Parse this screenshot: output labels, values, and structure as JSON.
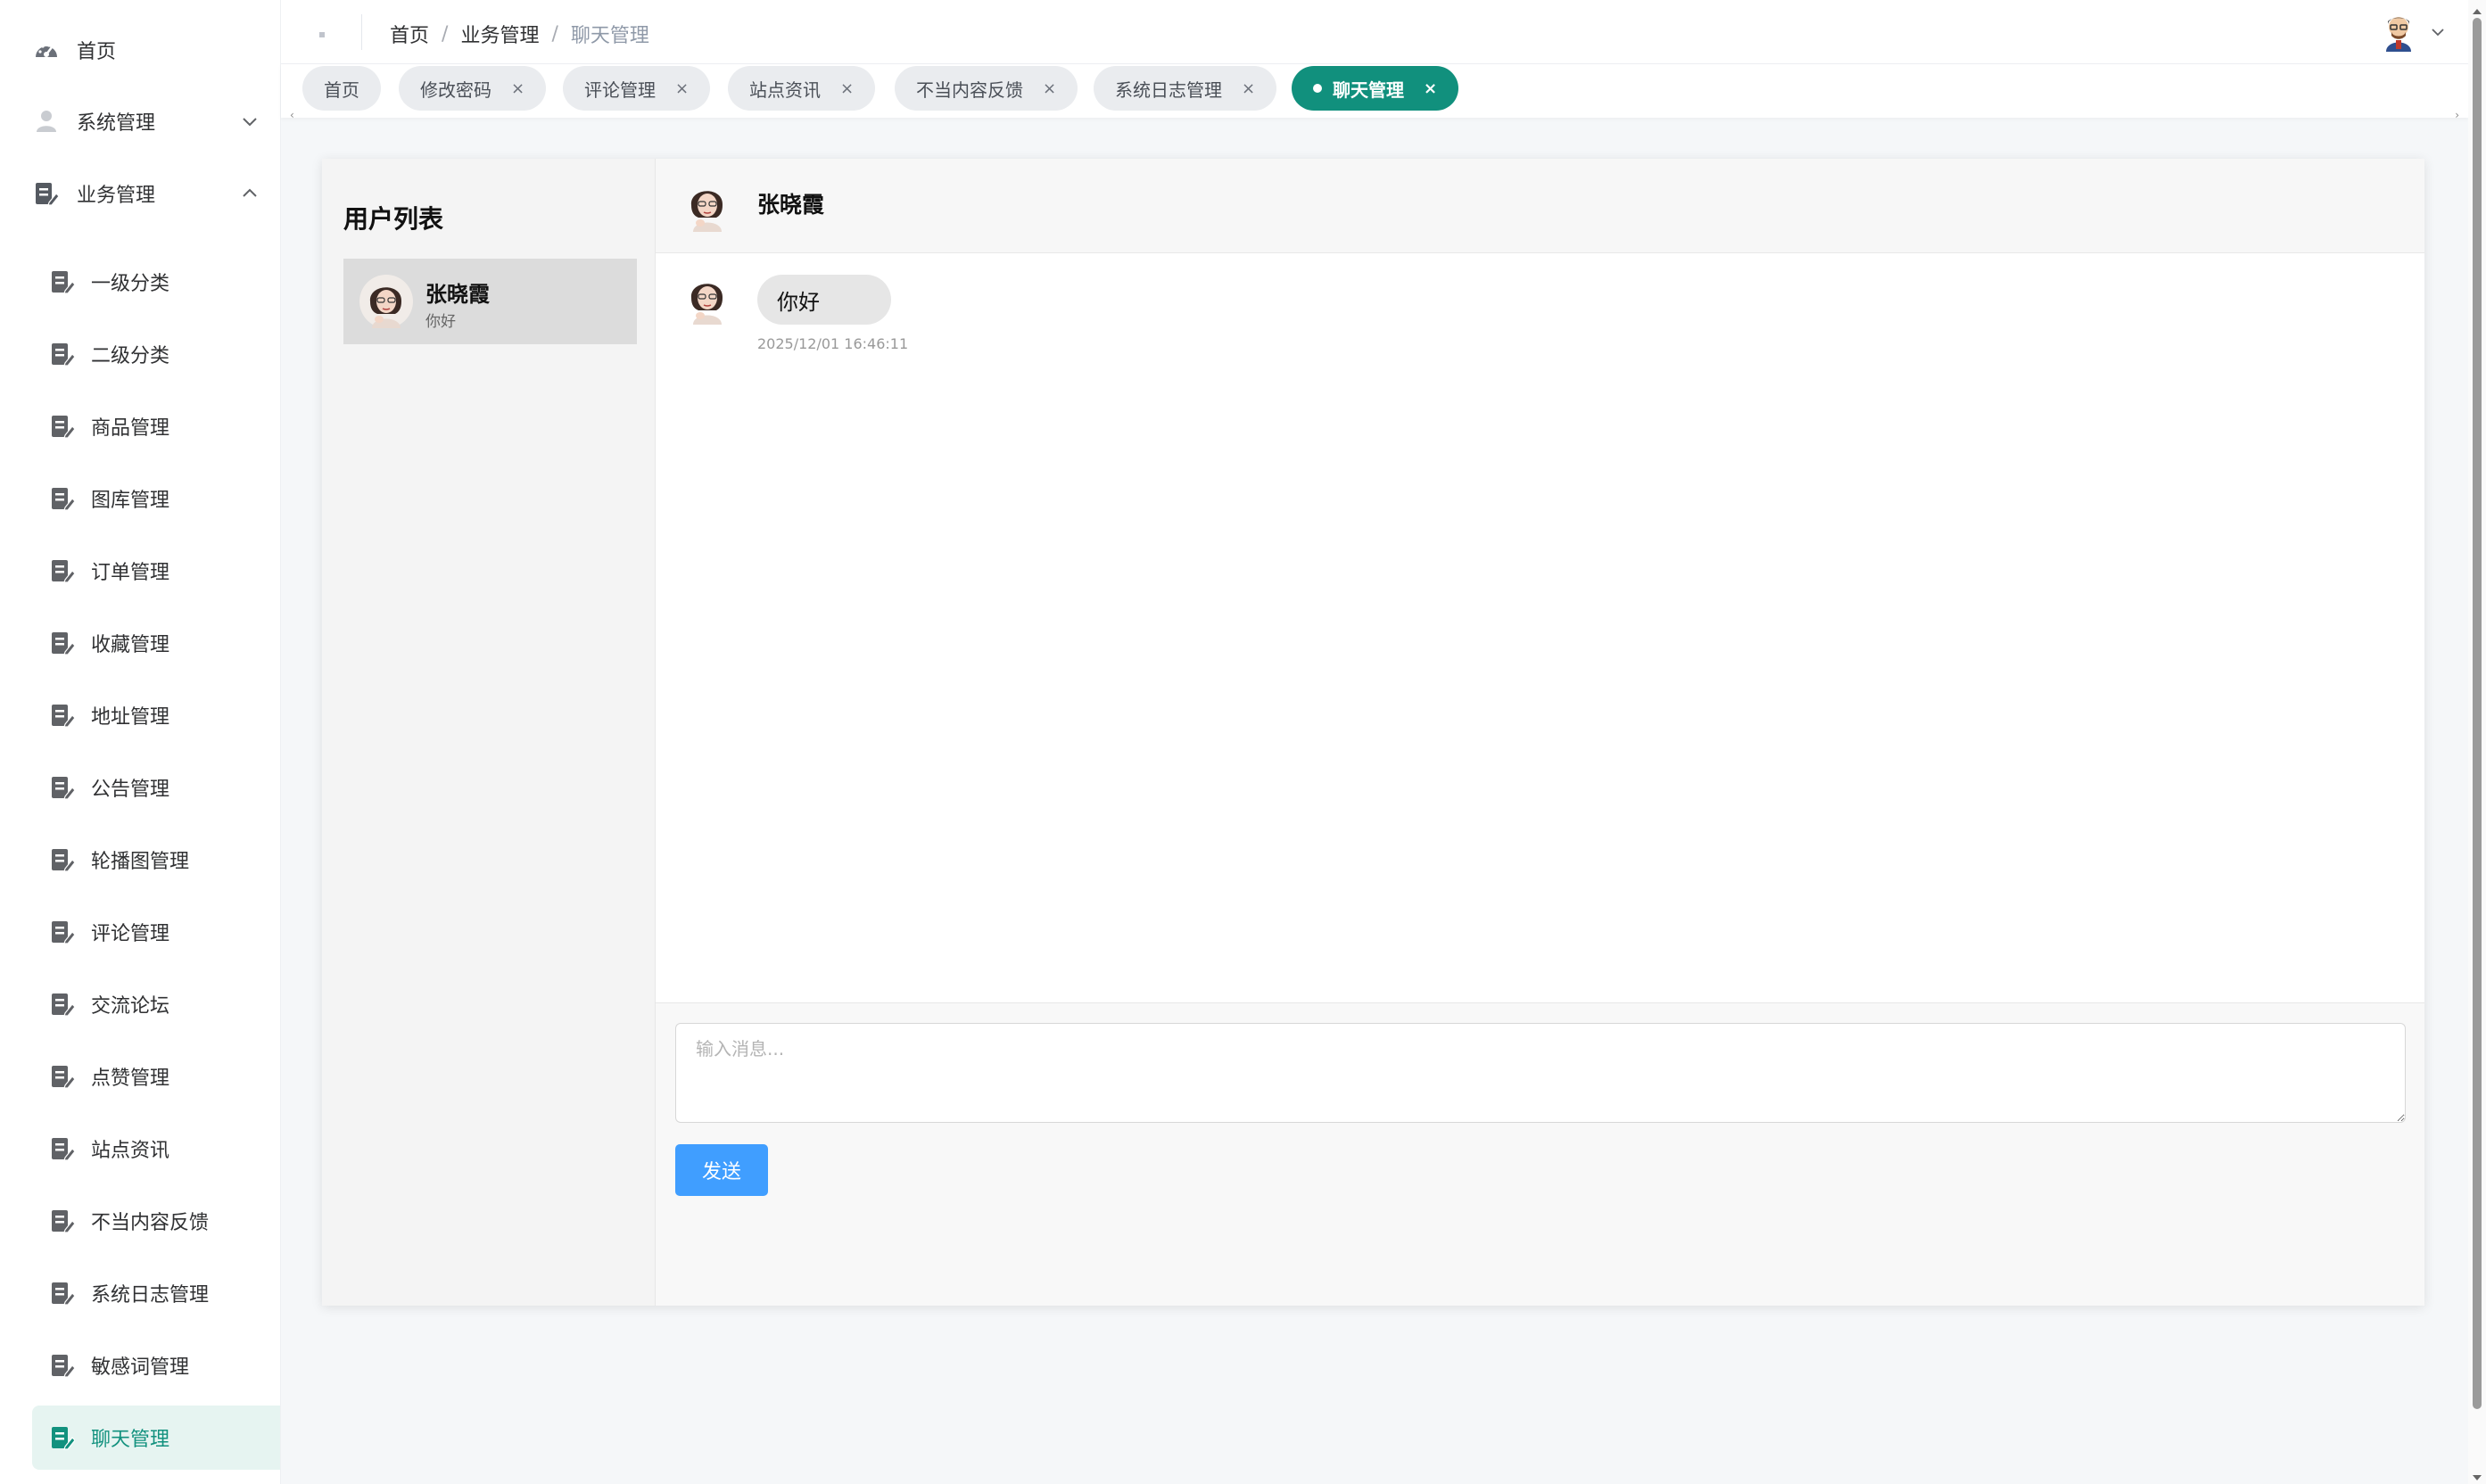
{
  "sidebar": {
    "top_items": [
      {
        "label": "首页",
        "icon": "dashboard-icon"
      },
      {
        "label": "系统管理",
        "icon": "user-icon",
        "expanded": false
      },
      {
        "label": "业务管理",
        "icon": "document-edit-icon",
        "expanded": true
      }
    ],
    "sub_items": [
      {
        "label": "一级分类"
      },
      {
        "label": "二级分类"
      },
      {
        "label": "商品管理"
      },
      {
        "label": "图库管理"
      },
      {
        "label": "订单管理"
      },
      {
        "label": "收藏管理"
      },
      {
        "label": "地址管理"
      },
      {
        "label": "公告管理"
      },
      {
        "label": "轮播图管理"
      },
      {
        "label": "评论管理"
      },
      {
        "label": "交流论坛"
      },
      {
        "label": "点赞管理"
      },
      {
        "label": "站点资讯"
      },
      {
        "label": "不当内容反馈"
      },
      {
        "label": "系统日志管理"
      },
      {
        "label": "敏感词管理"
      },
      {
        "label": "聊天管理",
        "active": true
      }
    ],
    "active_color": "#12917e"
  },
  "header": {
    "breadcrumb": [
      "首页",
      "业务管理",
      "聊天管理"
    ],
    "separator": "/"
  },
  "tabs": [
    {
      "label": "首页",
      "closable": false
    },
    {
      "label": "修改密码",
      "closable": true
    },
    {
      "label": "评论管理",
      "closable": true
    },
    {
      "label": "站点资讯",
      "closable": true
    },
    {
      "label": "不当内容反馈",
      "closable": true
    },
    {
      "label": "系统日志管理",
      "closable": true
    },
    {
      "label": "聊天管理",
      "closable": true,
      "active": true
    }
  ],
  "tab_close_glyph": "×",
  "accent_color": "#11907d",
  "chat": {
    "panel_title": "用户列表",
    "users": [
      {
        "name": "张晓霞",
        "last_message": "你好"
      }
    ],
    "current_user": "张晓霞",
    "messages": [
      {
        "text": "你好",
        "time": "2025/12/01 16:46:11"
      }
    ],
    "input_placeholder": "输入消息...",
    "send_label": "发送",
    "send_color": "#409eff"
  }
}
